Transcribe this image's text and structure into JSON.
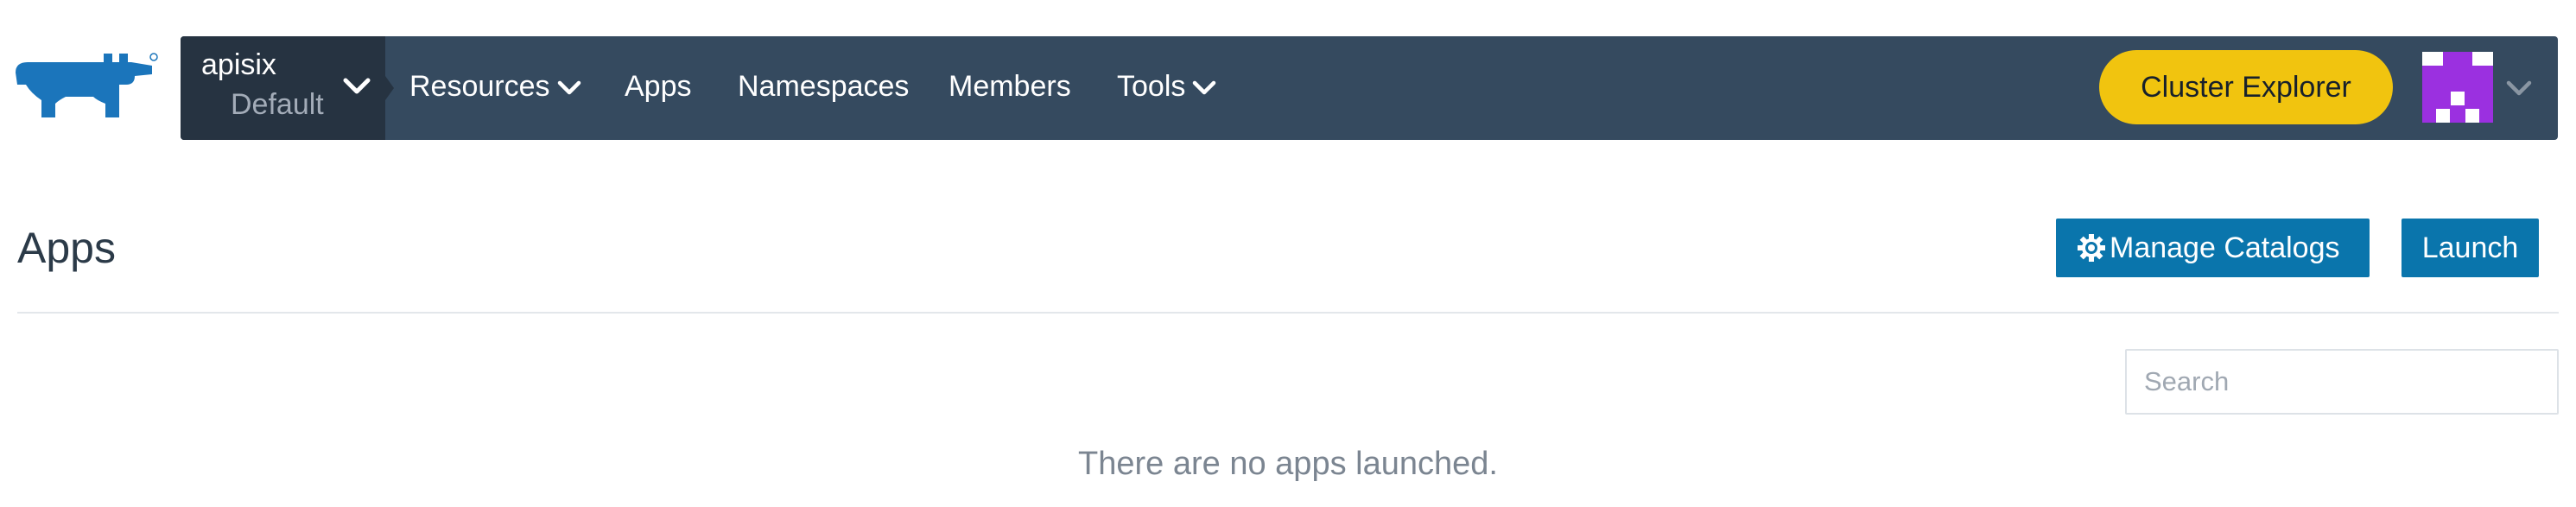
{
  "brand": {
    "logo_icon": "rancher-logo-icon",
    "color": "#1b75bb"
  },
  "context": {
    "cluster": "apisix",
    "project": "Default"
  },
  "nav": {
    "items": [
      {
        "label": "Resources",
        "has_dropdown": true
      },
      {
        "label": "Apps",
        "has_dropdown": false
      },
      {
        "label": "Namespaces",
        "has_dropdown": false
      },
      {
        "label": "Members",
        "has_dropdown": false
      },
      {
        "label": "Tools",
        "has_dropdown": true
      }
    ],
    "background": "#354a5f"
  },
  "header": {
    "cluster_explorer_label": "Cluster Explorer",
    "cluster_explorer_color": "#f1c40f",
    "avatar_color": "#9b30e0"
  },
  "page": {
    "title": "Apps",
    "manage_catalogs_label": "Manage Catalogs",
    "launch_label": "Launch",
    "button_color": "#0a75ac",
    "search_placeholder": "Search",
    "search_value": "",
    "empty_message": "There are no apps launched."
  }
}
